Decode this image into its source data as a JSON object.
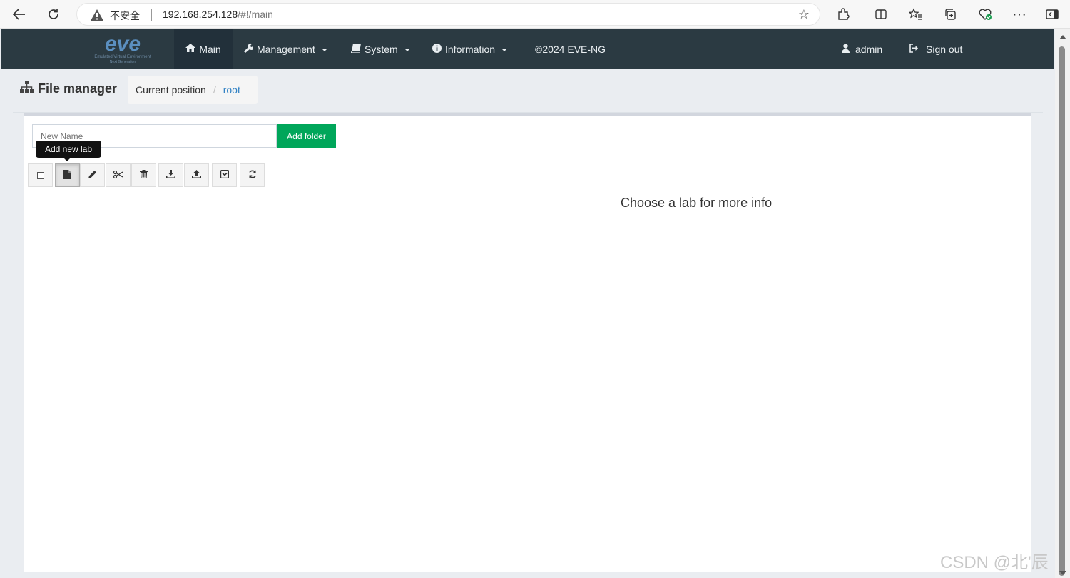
{
  "browser": {
    "insecure_label": "不安全",
    "url_host": "192.168.254.128",
    "url_path": "/#!/main"
  },
  "navbar": {
    "logo_text": "eve",
    "logo_subtitle": "Emulated Virtual Environment",
    "logo_subtitle2": "Next Generation",
    "items": [
      {
        "label": "Main",
        "icon": "home-icon"
      },
      {
        "label": "Management",
        "icon": "wrench-icon"
      },
      {
        "label": "System",
        "icon": "book-icon"
      },
      {
        "label": "Information",
        "icon": "info-icon"
      }
    ],
    "copyright": "©2024 EVE-NG",
    "user_label": "admin",
    "signout_label": "Sign out"
  },
  "page": {
    "title": "File manager",
    "breadcrumb_label": "Current position",
    "breadcrumb_sep": "/",
    "breadcrumb_root": "root"
  },
  "panel": {
    "newname_placeholder": "New Name",
    "addfolder_label": "Add folder",
    "tooltip": "Add new lab",
    "info_text": "Choose a lab for more info"
  },
  "toolbar": [
    {
      "name": "select-all-checkbox",
      "icon": "checkbox-icon"
    },
    {
      "name": "add-lab-button",
      "icon": "file-icon"
    },
    {
      "name": "rename-button",
      "icon": "pencil-icon"
    },
    {
      "name": "move-button",
      "icon": "scissors-icon"
    },
    {
      "name": "delete-button",
      "icon": "trash-icon"
    },
    {
      "name": "import-button",
      "icon": "download-icon"
    },
    {
      "name": "export-button",
      "icon": "upload-icon"
    },
    {
      "name": "select-archive-button",
      "icon": "archive-icon"
    },
    {
      "name": "refresh-button",
      "icon": "refresh-icon"
    }
  ],
  "watermark": "CSDN @北'辰",
  "colors": {
    "navbar_bg": "#2b3a42",
    "accent_green": "#00a65a",
    "link_blue": "#2f80c3"
  }
}
